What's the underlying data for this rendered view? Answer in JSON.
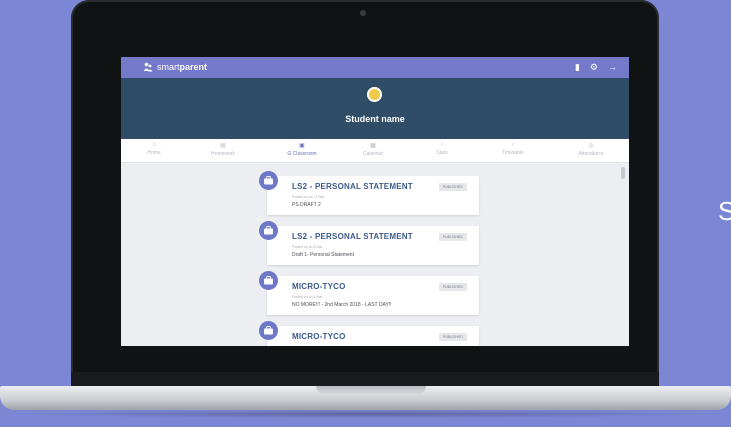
{
  "side_text": "S",
  "app": {
    "logo_prefix": "smart",
    "logo_suffix": "parent",
    "student_name": "Student name",
    "top_icons": [
      "book-icon",
      "gear-icon",
      "logout-icon"
    ]
  },
  "tabs": [
    {
      "label": "Home",
      "icon": "home-icon",
      "active": false
    },
    {
      "label": "Homework",
      "icon": "homework-icon",
      "active": false
    },
    {
      "label": "G Classroom",
      "icon": "classroom-icon",
      "active": true
    },
    {
      "label": "Calendar",
      "icon": "calendar-icon",
      "active": false
    },
    {
      "label": "Stats",
      "icon": "stats-icon",
      "active": false
    },
    {
      "label": "Timetable",
      "icon": "timetable-icon",
      "active": false
    },
    {
      "label": "Attendance",
      "icon": "attendance-icon",
      "active": false
    }
  ],
  "cards": [
    {
      "title": "LS2 - PERSONAL STATEMENT",
      "meta": "Posted on on 27 Mar",
      "sub": "PS DRAFT 2",
      "badge": "PUBLISHED"
    },
    {
      "title": "LS2 - PERSONAL STATEMENT",
      "meta": "Posted on on 6 Mar",
      "sub": "Draft 1- Personal Statement",
      "badge": "PUBLISHED"
    },
    {
      "title": "MICRO-TYCO",
      "meta": "Posted on on 1 Mar",
      "sub": "NO MORE!!! - 2nd March 2018 - LAST DAY!!",
      "badge": "PUBLISHED"
    },
    {
      "title": "MICRO-TYCO",
      "meta": "",
      "sub": "",
      "badge": "PUBLISHED"
    }
  ]
}
